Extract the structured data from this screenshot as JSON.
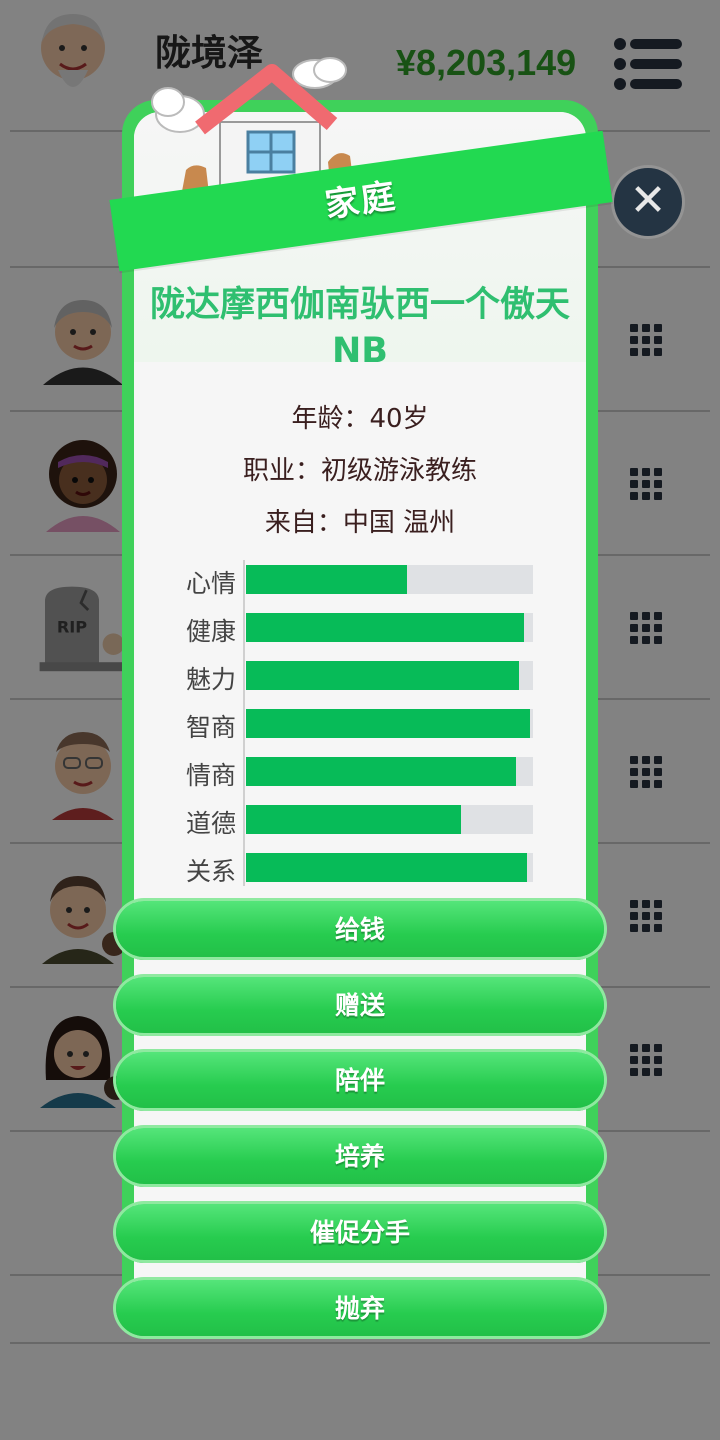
{
  "header": {
    "player_name": "陇境泽",
    "money": "¥8,203,149"
  },
  "modal": {
    "title": "家庭",
    "person_name_line1": "陇达摩西伽南驮西一个傲天",
    "person_name_line2": "NB",
    "age": "年龄：40岁",
    "job": "职业：初级游泳教练",
    "origin": "来自：中国 温州",
    "stats": [
      {
        "label": "心情",
        "value": 0.56
      },
      {
        "label": "健康",
        "value": 0.97
      },
      {
        "label": "魅力",
        "value": 0.95
      },
      {
        "label": "智商",
        "value": 0.99
      },
      {
        "label": "情商",
        "value": 0.94
      },
      {
        "label": "道德",
        "value": 0.75
      },
      {
        "label": "关系",
        "value": 0.98
      }
    ],
    "actions": [
      "给钱",
      "赠送",
      "陪伴",
      "培养",
      "催促分手",
      "抛弃"
    ]
  },
  "background_rows": {
    "tombstone_text": "RIP"
  },
  "colors": {
    "accent_green": "#22d951",
    "bar_fill": "#07bb58",
    "bar_track": "#dfe1e4",
    "name_color": "#2fbf70",
    "money_color": "#2f9e27"
  }
}
